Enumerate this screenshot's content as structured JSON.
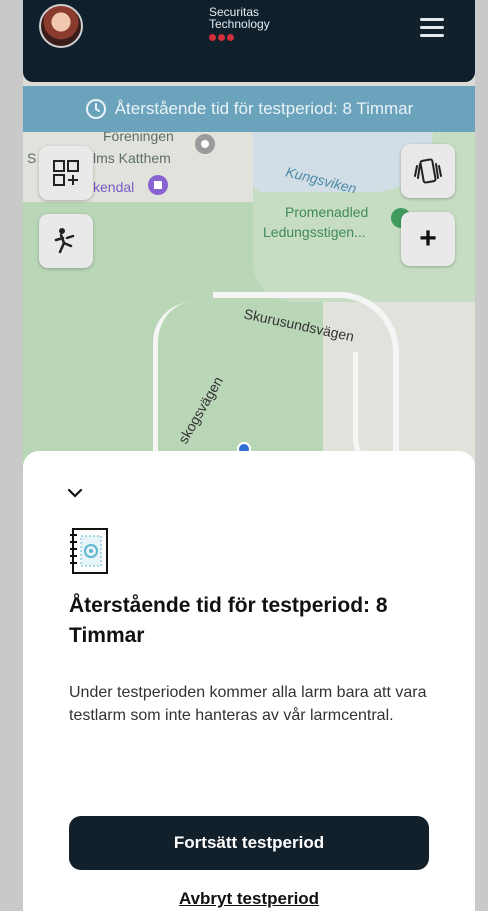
{
  "header": {
    "logo_line1": "Securitas",
    "logo_line2": "Technology",
    "menu_icon": "hamburger-menu-icon"
  },
  "banner": {
    "icon": "clock-icon",
    "text": "Återstående tid för testperiod: 8 Timmar"
  },
  "map": {
    "labels": {
      "foreningen": "Föreningen",
      "katthem": "lms Katthem",
      "kendal": "kendal",
      "kungsviken": "Kungsviken",
      "promenadled": "Promenadled",
      "ledungsstigen": "Ledungsstigen...",
      "skurusundsvagen": "Skurusundsvägen",
      "skogsvagen": "skogsvägen",
      "s_letter": "S"
    },
    "buttons": {
      "add_widget": "add-widget-grid-icon",
      "fall": "fall-detection-icon",
      "vibrate": "vibrate-phone-icon",
      "zoom_in": "+"
    }
  },
  "sheet": {
    "collapse_icon": "chevron-down-icon",
    "book_icon": "notebook-icon",
    "title": "Återstående tid för testperiod: 8 Timmar",
    "description": "Under testperioden kommer alla larm bara att vara testlarm som inte hanteras av vår larmcentral.",
    "continue_button": "Fortsätt testperiod",
    "cancel_link": "Avbryt testperiod"
  },
  "colors": {
    "header_bg": "#0f1f2b",
    "banner_bg": "#6aa3bb",
    "button_bg": "#12202c",
    "logo_dots": "#d0303a"
  }
}
